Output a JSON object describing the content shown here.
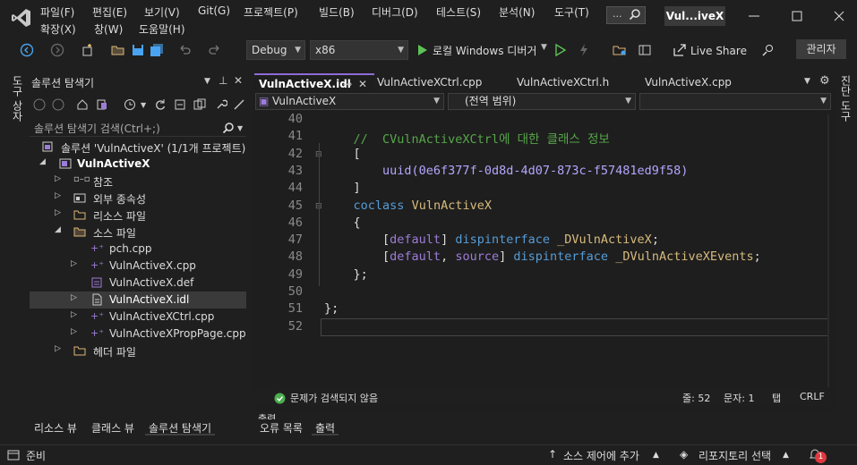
{
  "menu": {
    "file": "파일(F)",
    "edit": "편집(E)",
    "view": "보기(V)",
    "git": "Git(G)",
    "project": "프로젝트(P)",
    "build": "빌드(B)",
    "debug": "디버그(D)",
    "test": "테스트(S)",
    "analyze": "분석(N)",
    "tools": "도구(T)",
    "extensions": "확장(X)",
    "window": "창(W)",
    "help": "도움말(H)"
  },
  "search": {
    "placeholder": "..."
  },
  "title": "Vul...iveX",
  "toolbar": {
    "config": "Debug",
    "platform": "x86",
    "run_label": "로컬 Windows 디버거",
    "live_share": "Live Share",
    "admin": "관리자"
  },
  "left_strip": {
    "label": "도구 상자"
  },
  "right_strip": {
    "label": "진단 도구"
  },
  "solution_explorer": {
    "title": "솔루션 탐색기",
    "search_placeholder": "솔루션 탐색기 검색(Ctrl+;)",
    "solution_label": "솔루션 'VulnActiveX' (1/1개 프로젝트)",
    "project": "VulnActiveX",
    "items": [
      {
        "label": "참조"
      },
      {
        "label": "외부 종속성"
      },
      {
        "label": "리소스 파일"
      },
      {
        "label": "소스 파일"
      },
      {
        "label": "pch.cpp"
      },
      {
        "label": "VulnActiveX.cpp"
      },
      {
        "label": "VulnActiveX.def"
      },
      {
        "label": "VulnActiveX.idl"
      },
      {
        "label": "VulnActiveXCtrl.cpp"
      },
      {
        "label": "VulnActiveXPropPage.cpp"
      },
      {
        "label": "헤더 파일"
      }
    ],
    "bottom_tabs": [
      "리소스 뷰",
      "클래스 뷰",
      "솔루션 탐색기"
    ]
  },
  "editor": {
    "tabs": [
      "VulnActiveX.idl",
      "VulnActiveXCtrl.cpp",
      "VulnActiveXCtrl.h",
      "VulnActiveX.cpp"
    ],
    "nav_project": "VulnActiveX",
    "nav_scope": "(전역 범위)",
    "lines": [
      {
        "n": "40",
        "code": ""
      },
      {
        "n": "41",
        "code": "    //  CVulnActiveXCtrl에 대한 클래스 정보"
      },
      {
        "n": "42",
        "code": "    ["
      },
      {
        "n": "43",
        "code": "        uuid(0e6f377f-0d8d-4d07-873c-f57481ed9f58)"
      },
      {
        "n": "44",
        "code": "    ]"
      },
      {
        "n": "45",
        "code": "    coclass VulnActiveX"
      },
      {
        "n": "46",
        "code": "    {"
      },
      {
        "n": "47",
        "code": "        [default] dispinterface _DVulnActiveX;"
      },
      {
        "n": "48",
        "code": "        [default, source] dispinterface _DVulnActiveXEvents;"
      },
      {
        "n": "49",
        "code": "    };"
      },
      {
        "n": "50",
        "code": ""
      },
      {
        "n": "51",
        "code": "};"
      },
      {
        "n": "52",
        "code": ""
      }
    ]
  },
  "status": {
    "issues": "문제가 검색되지 않음",
    "line": "줄: 52",
    "col": "문자: 1",
    "tab": "탭",
    "eol": "CRLF"
  },
  "output_panel": {
    "title": "출력",
    "tabs": [
      "오류 목록",
      "출력"
    ]
  },
  "statusbar": {
    "ready": "준비",
    "source_control": "소스 제어에 추가",
    "repo": "리포지토리 선택",
    "notifications": "1"
  },
  "colors": {
    "accent": "#8f6ad4",
    "keyword": "#569cd6",
    "comment": "#57a64a",
    "uuid": "#b5a6ff",
    "attr": "#9d7cd8",
    "ident": "#d7ba7d"
  }
}
